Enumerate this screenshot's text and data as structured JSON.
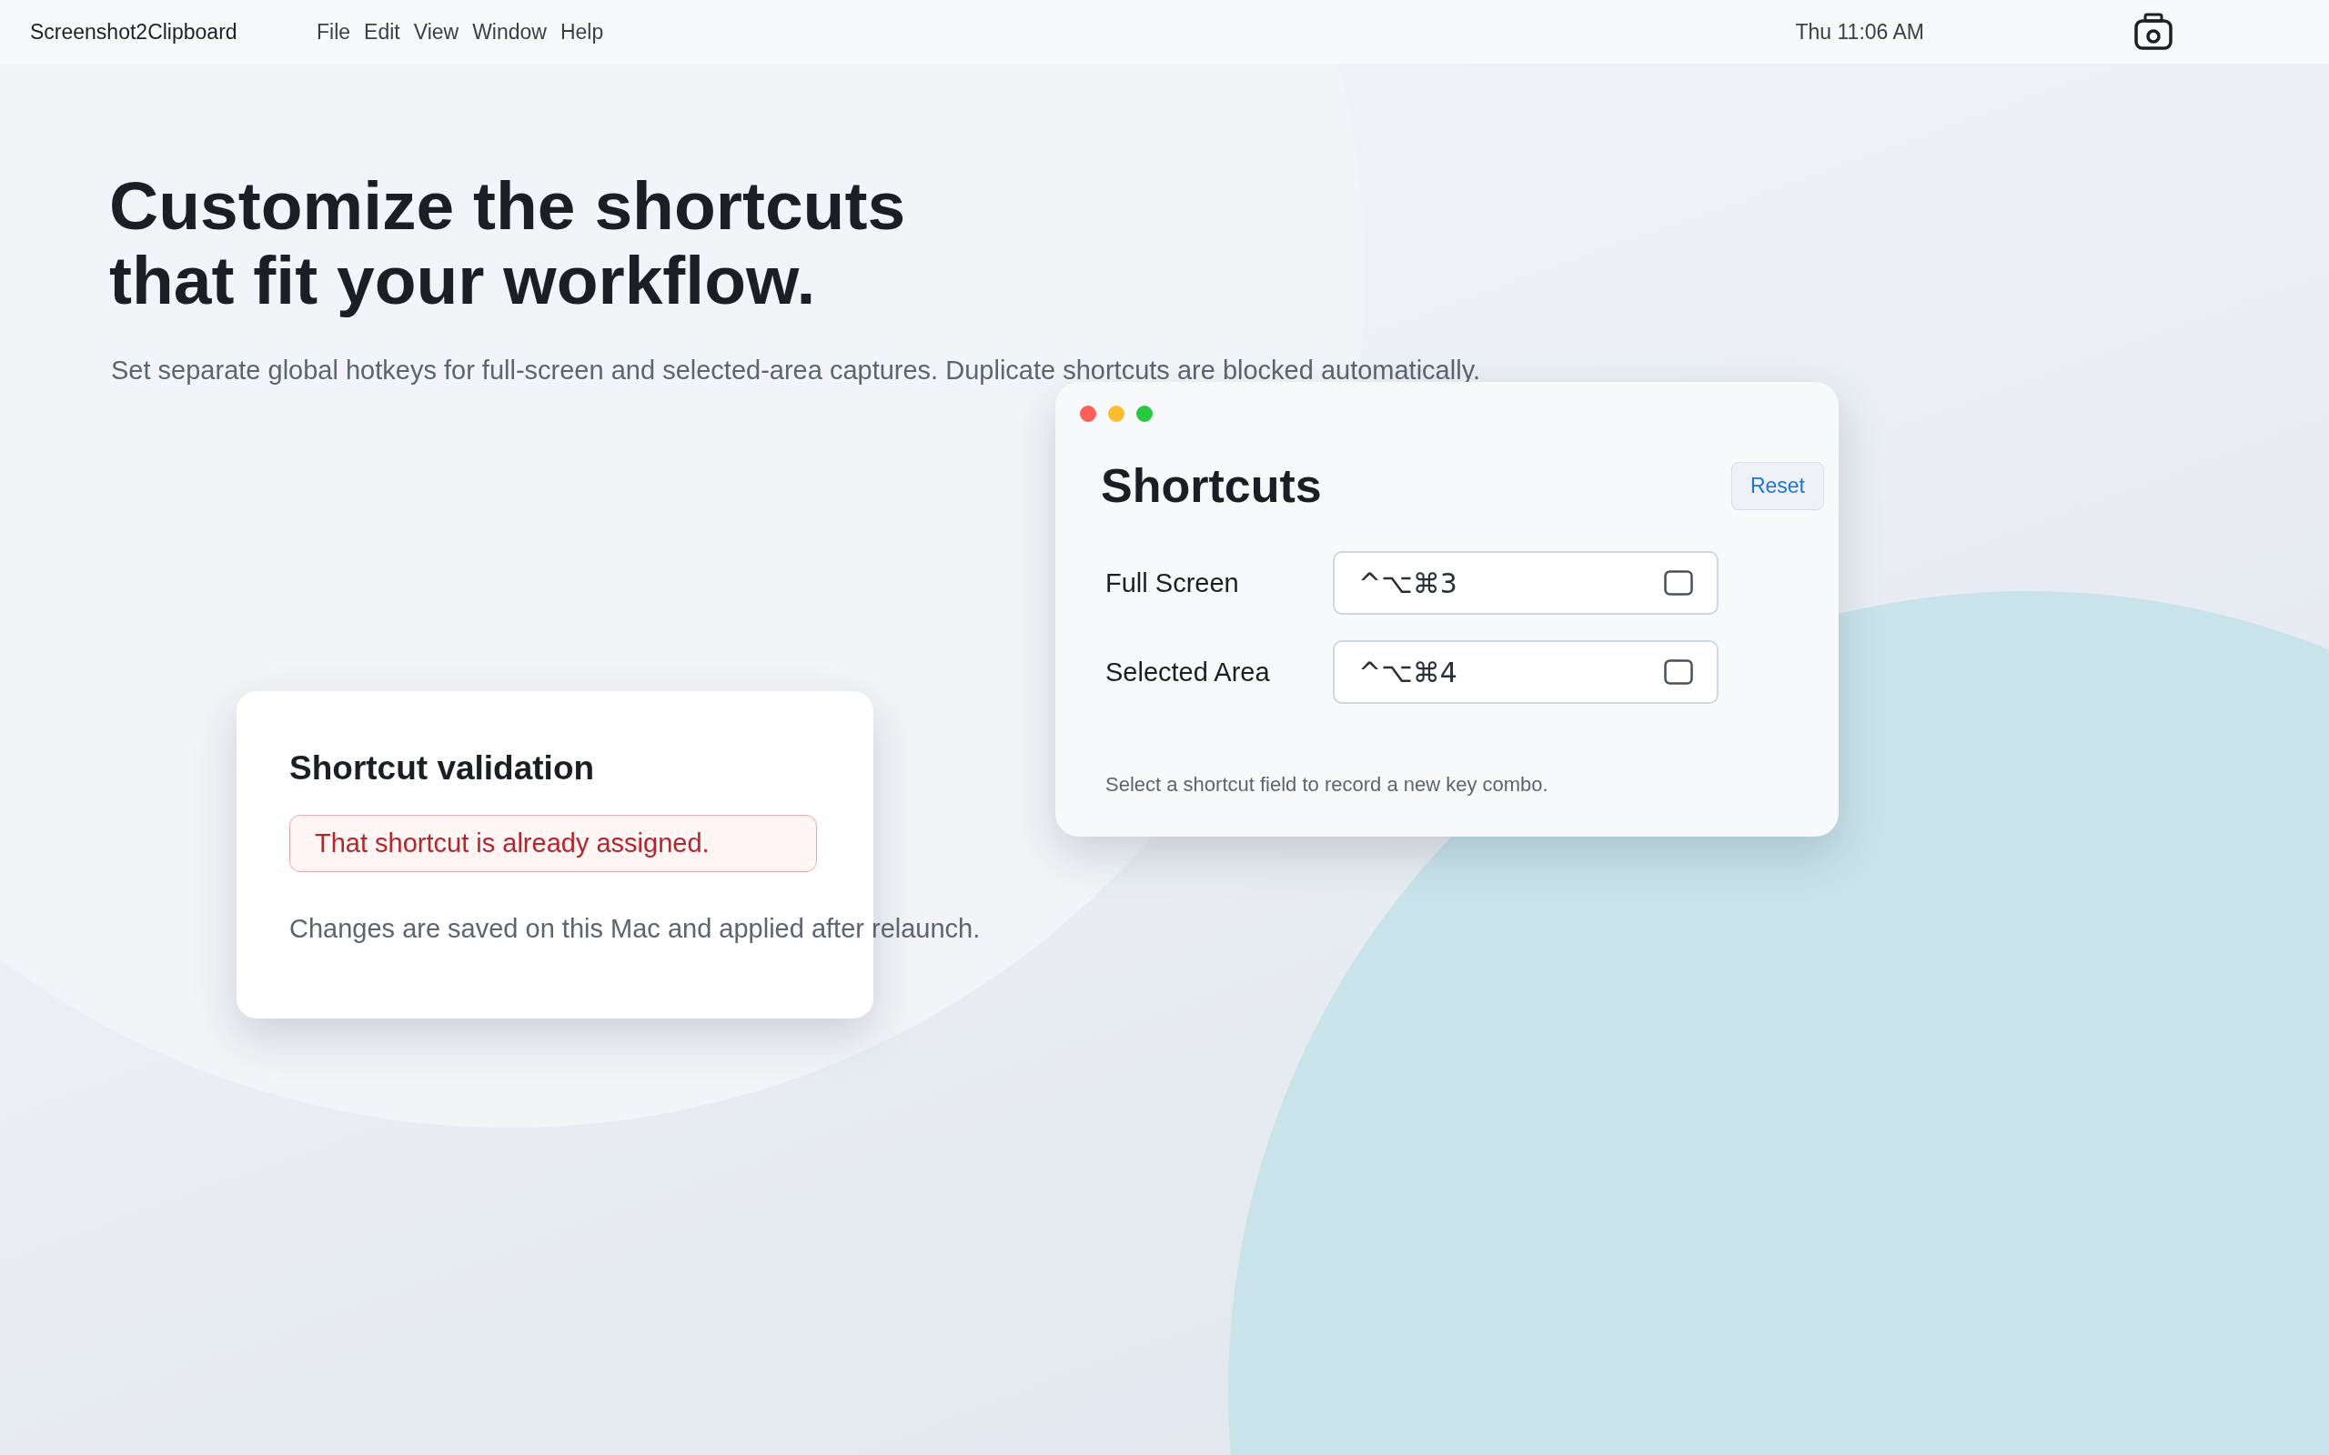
{
  "menu_bar": {
    "app_name": "Screenshot2Clipboard",
    "menus": [
      "File",
      "Edit",
      "View",
      "Window",
      "Help"
    ],
    "clock": "Thu 11:06 AM"
  },
  "hero": {
    "title_lines": [
      "Customize the shortcuts",
      "that fit your workflow."
    ],
    "subtitle": "Set separate global hotkeys for full-screen and selected-area captures. Duplicate shortcuts are blocked automatically."
  },
  "shortcuts_window": {
    "title": "Shortcuts",
    "reset_button": "Reset",
    "rows": [
      {
        "label": "Full Screen",
        "value": "^⌥⌘3"
      },
      {
        "label": "Selected Area",
        "value": "^⌥⌘4"
      }
    ],
    "hint": "Select a shortcut field to record a new key combo."
  },
  "validation_card": {
    "title": "Shortcut validation",
    "error": "That shortcut is already assigned.",
    "note": "Changes are saved on this Mac and applied after relaunch."
  }
}
